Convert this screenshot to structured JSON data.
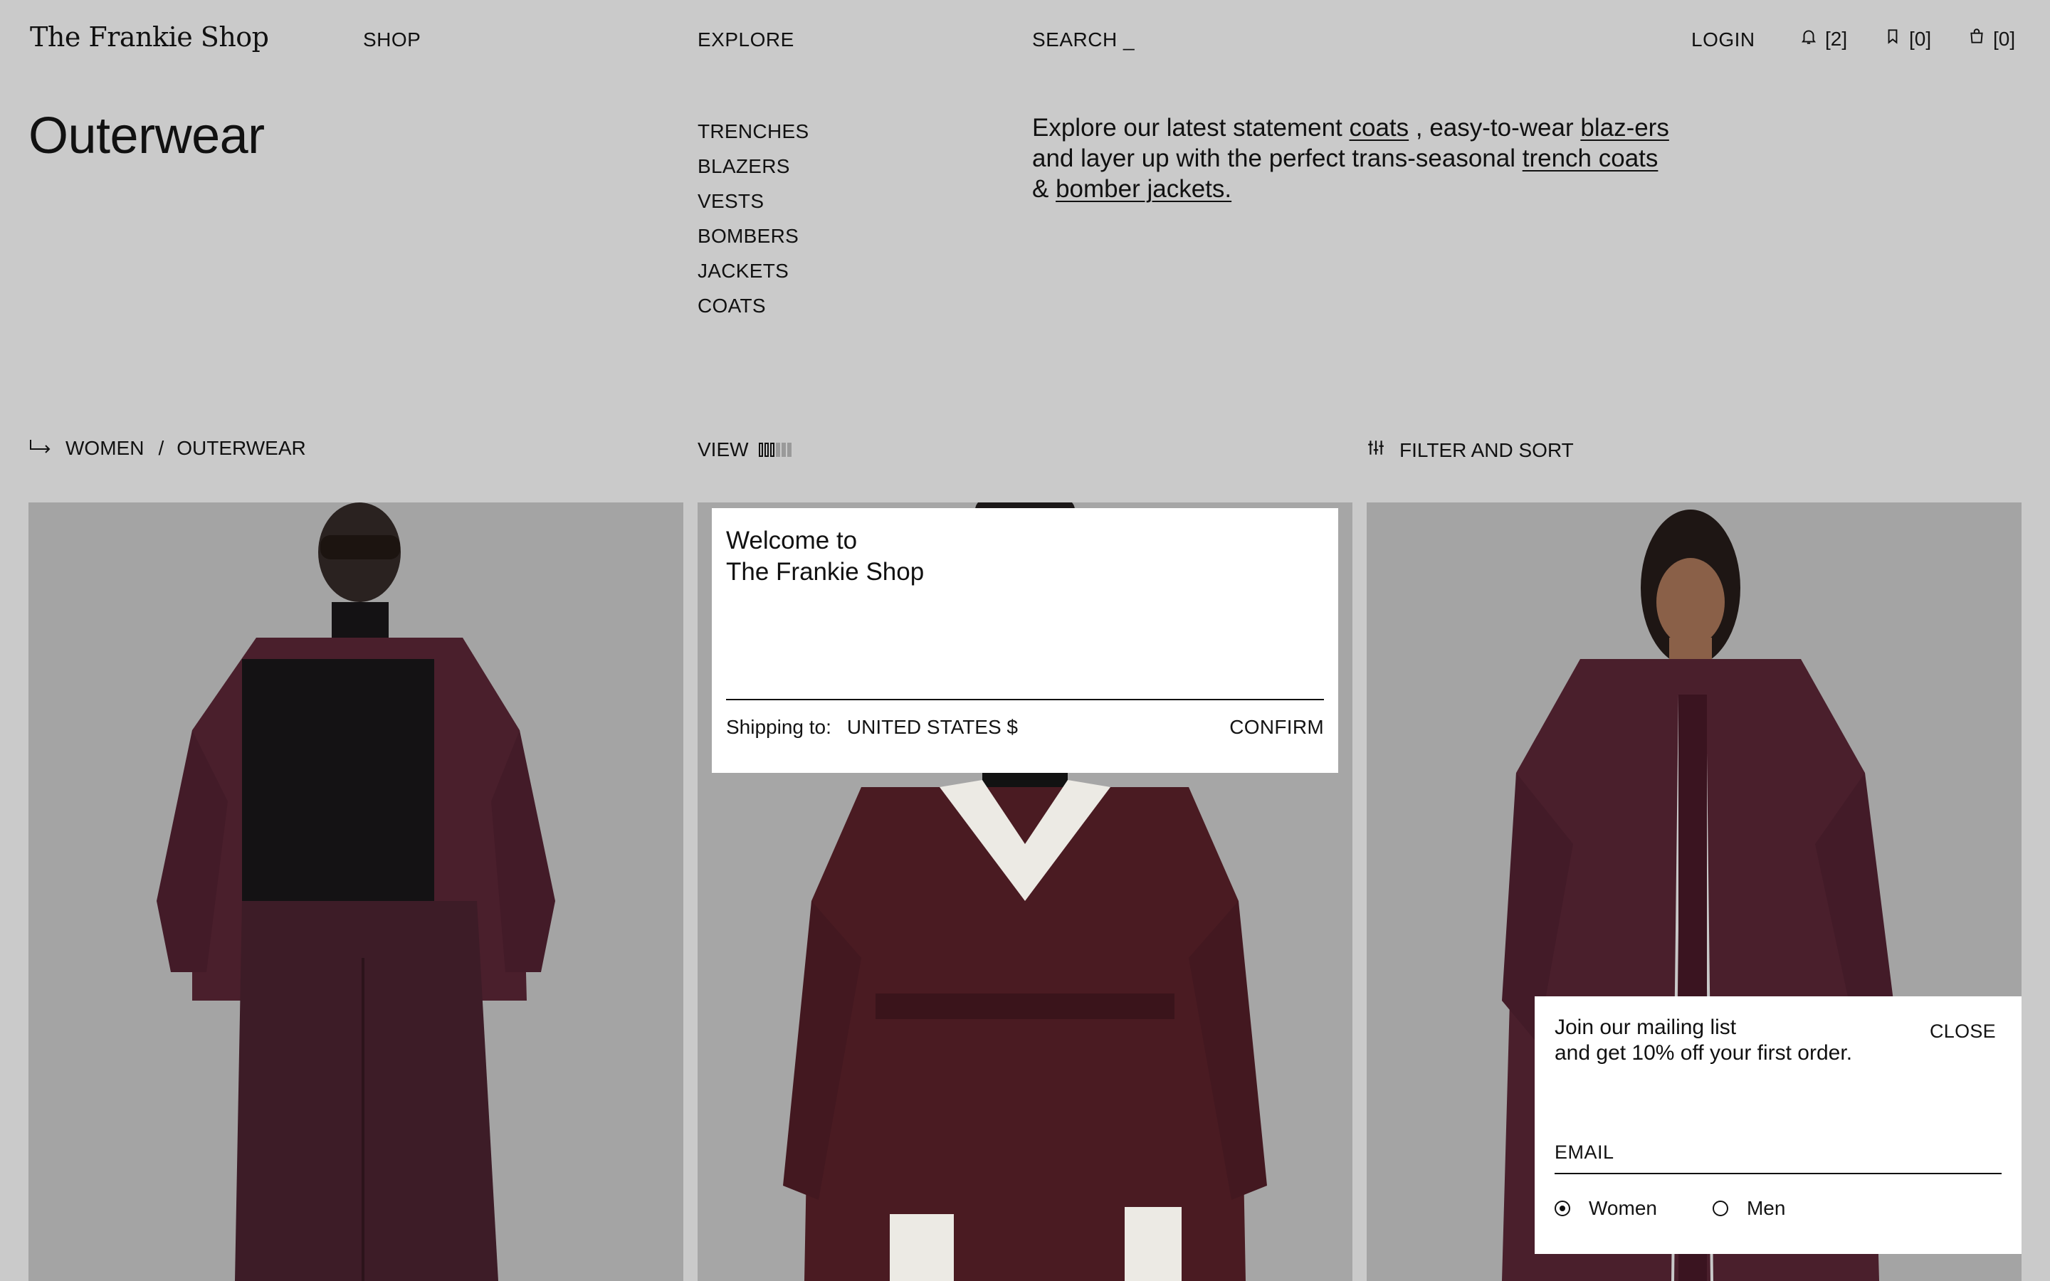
{
  "header": {
    "logo": "The Frankie Shop",
    "nav": {
      "shop": "SHOP",
      "explore": "EXPLORE",
      "search": "SEARCH _",
      "login": "LOGIN"
    },
    "counters": {
      "notifications": "[2]",
      "wishlist": "[0]",
      "bag": "[0]"
    }
  },
  "page": {
    "title": "Outerwear",
    "categories": [
      "TRENCHES",
      "BLAZERS",
      "VESTS",
      "BOMBERS",
      "JACKETS",
      "COATS"
    ],
    "intro": {
      "p1": "Explore our latest statement ",
      "link_coats": "coats",
      "p2": " , easy-to-wear ",
      "link_blazers": "blaz-ers",
      "p3": " and layer up with the perfect trans-seasonal ",
      "link_trench": "trench coats",
      "p4": " & ",
      "link_bomber": "bomber jackets."
    }
  },
  "toolbar": {
    "breadcrumb": {
      "parent": "WOMEN",
      "separator": "/",
      "current": "OUTERWEAR"
    },
    "view_label": "VIEW",
    "filter_label": "FILTER AND SORT"
  },
  "welcome_modal": {
    "title_line1": "Welcome to",
    "title_line2": "The Frankie Shop",
    "shipping_label": "Shipping to:",
    "country": "UNITED STATES $",
    "confirm": "CONFIRM"
  },
  "mailing_modal": {
    "line1": "Join our mailing list",
    "line2": "and get 10% off your first order.",
    "close": "CLOSE",
    "email_placeholder": "EMAIL",
    "options": [
      {
        "label": "Women",
        "selected": true
      },
      {
        "label": "Men",
        "selected": false
      }
    ]
  },
  "colors": {
    "page_bg": "#cacaca",
    "photo_bg": "#a3a3a3",
    "garment_plum": "#4a1f2c",
    "modal_bg": "#ffffff",
    "text": "#141414"
  }
}
